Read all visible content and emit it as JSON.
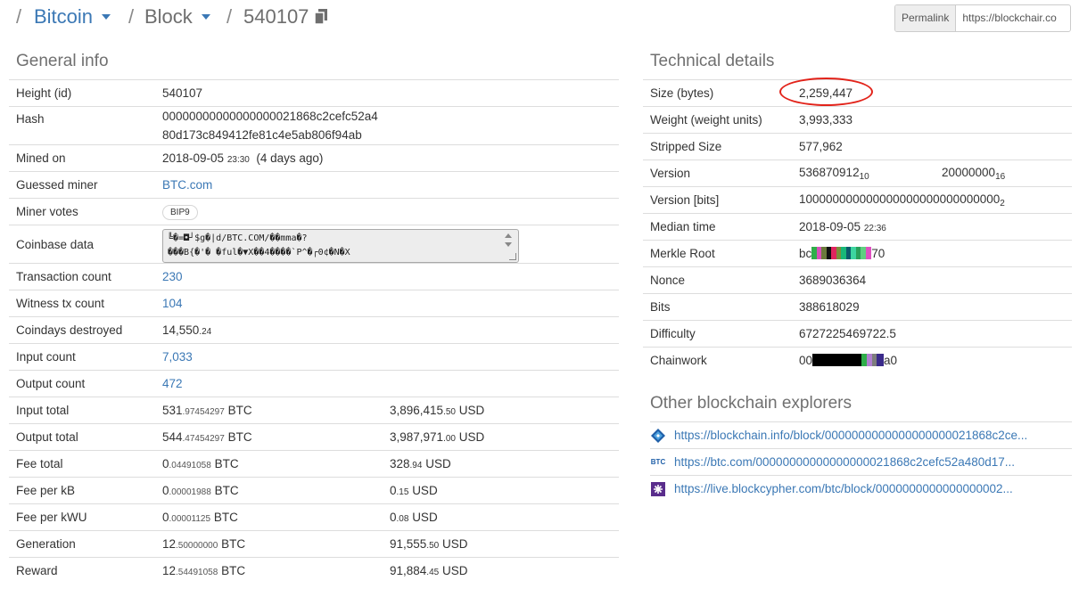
{
  "breadcrumb": {
    "sep": "/",
    "coin": "Bitcoin",
    "type": "Block",
    "block_id": "540107"
  },
  "permalink": {
    "label": "Permalink",
    "value": "https://blockchair.co"
  },
  "general": {
    "title": "General info",
    "height_label": "Height (id)",
    "height": "540107",
    "hash_label": "Hash",
    "hash_line1": "00000000000000000021868c2cefc52a4",
    "hash_line2": "80d173c849412fe81c4e5ab806f94ab",
    "mined_label": "Mined on",
    "mined_date": "2018-09-05",
    "mined_time": "23:30",
    "mined_ago": "(4 days ago)",
    "miner_label": "Guessed miner",
    "miner": "BTC.com",
    "votes_label": "Miner votes",
    "votes_badge": "BIP9",
    "coinbase_label": "Coinbase data",
    "coinbase_line1": "╚�=◘┘$g�|d/BTC.COM/��mma�?",
    "coinbase_line2": "���B{�'� �ful�▼X��4����`P^�┌0¢�N�X",
    "tx_count_label": "Transaction count",
    "tx_count": "230",
    "witness_label": "Witness tx count",
    "witness": "104",
    "coindays_label": "Coindays destroyed",
    "coindays_int": "14,550",
    "coindays_dec": ".24",
    "input_count_label": "Input count",
    "input_count": "7,033",
    "output_count_label": "Output count",
    "output_count": "472",
    "input_total_label": "Input total",
    "input_total_btc_int": "531",
    "input_total_btc_dec": ".97454297",
    "input_total_usd_int": "3,896,415",
    "input_total_usd_dec": ".50",
    "output_total_label": "Output total",
    "output_total_btc_int": "544",
    "output_total_btc_dec": ".47454297",
    "output_total_usd_int": "3,987,971",
    "output_total_usd_dec": ".00",
    "fee_total_label": "Fee total",
    "fee_total_btc_int": "0",
    "fee_total_btc_dec": ".04491058",
    "fee_total_usd_int": "328",
    "fee_total_usd_dec": ".94",
    "fee_kb_label": "Fee per kB",
    "fee_kb_btc_int": "0",
    "fee_kb_btc_dec": ".00001988",
    "fee_kb_usd_int": "0",
    "fee_kb_usd_dec": ".15",
    "fee_kwu_label": "Fee per kWU",
    "fee_kwu_btc_int": "0",
    "fee_kwu_btc_dec": ".00001125",
    "fee_kwu_usd_int": "0",
    "fee_kwu_usd_dec": ".08",
    "generation_label": "Generation",
    "generation_btc_int": "12",
    "generation_btc_dec": ".50000000",
    "generation_usd_int": "91,555",
    "generation_usd_dec": ".50",
    "reward_label": "Reward",
    "reward_btc_int": "12",
    "reward_btc_dec": ".54491058",
    "reward_usd_int": "91,884",
    "reward_usd_dec": ".45",
    "btc_unit": "BTC",
    "usd_unit": "USD"
  },
  "technical": {
    "title": "Technical details",
    "size_label": "Size (bytes)",
    "size": "2,259,447",
    "weight_label": "Weight (weight units)",
    "weight": "3,993,333",
    "stripped_label": "Stripped Size",
    "stripped": "577,962",
    "version_label": "Version",
    "version_dec": "536870912",
    "version_dec_base": "10",
    "version_hex": "20000000",
    "version_hex_base": "16",
    "version_bits_label": "Version [bits]",
    "version_bits": "100000000000000000000000000000",
    "version_bits_base": "2",
    "median_label": "Median time",
    "median_date": "2018-09-05",
    "median_time": "22:36",
    "merkle_label": "Merkle Root",
    "merkle_start": "bc",
    "merkle_end": "70",
    "nonce_label": "Nonce",
    "nonce": "3689036364",
    "bits_label": "Bits",
    "bits": "388618029",
    "difficulty_label": "Difficulty",
    "difficulty": "6727225469722.5",
    "chainwork_label": "Chainwork",
    "chainwork_start": "00",
    "chainwork_end": "a0",
    "highlight_color": "#e2231a"
  },
  "explorers": {
    "title": "Other blockchain explorers",
    "items": [
      {
        "icon": "blockchain-info-icon",
        "url": "https://blockchain.info/block/0000000000000000000021868c2ce..."
      },
      {
        "icon": "btc-com-icon",
        "icon_text": "BTC",
        "url": "https://btc.com/00000000000000000021868c2cefc52a480d17..."
      },
      {
        "icon": "blockcypher-icon",
        "url": "https://live.blockcypher.com/btc/block/0000000000000000002..."
      }
    ]
  }
}
